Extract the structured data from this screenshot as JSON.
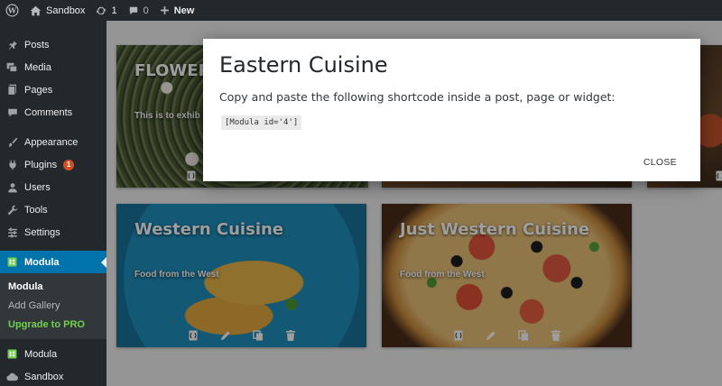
{
  "adminbar": {
    "site_name": "Sandbox",
    "updates_count": "1",
    "comments_count": "0",
    "new_label": "New"
  },
  "sidebar": {
    "items": [
      {
        "label": "Posts",
        "icon": "pin-icon"
      },
      {
        "label": "Media",
        "icon": "media-icon"
      },
      {
        "label": "Pages",
        "icon": "pages-icon"
      },
      {
        "label": "Comments",
        "icon": "comments-icon"
      },
      {
        "label": "Appearance",
        "icon": "brush-icon"
      },
      {
        "label": "Plugins",
        "icon": "plug-icon",
        "badge": "1"
      },
      {
        "label": "Users",
        "icon": "user-icon"
      },
      {
        "label": "Tools",
        "icon": "wrench-icon"
      },
      {
        "label": "Settings",
        "icon": "settings-icon"
      },
      {
        "label": "Modula",
        "icon": "modula-icon"
      }
    ],
    "submenu": [
      "Modula",
      "Add Gallery",
      "Upgrade to PRO"
    ],
    "bottom_items": [
      {
        "label": "Modula",
        "icon": "modula-icon"
      },
      {
        "label": "Sandbox",
        "icon": "cloud-icon"
      }
    ]
  },
  "gallery": {
    "cards": [
      {
        "title": "FLOWERS",
        "description": "This is to exhib"
      },
      {
        "title": "",
        "description": ""
      },
      {
        "title": "",
        "description": ""
      },
      {
        "title": "Western Cuisine",
        "description": "Food from the West"
      },
      {
        "title": "Just Western Cuisine",
        "description": "Food from the West"
      }
    ],
    "action_icons": [
      "shortcode-icon",
      "edit-icon",
      "duplicate-icon",
      "delete-icon"
    ]
  },
  "modal": {
    "title": "Eastern Cuisine",
    "text": "Copy and paste the following shortcode inside a post, page or widget:",
    "shortcode": "[Modula id='4']",
    "close_label": "CLOSE"
  },
  "colors": {
    "adminbar_bg": "#23282d",
    "sidebar_bg": "#23282d",
    "active_menu": "#0073aa",
    "submenu_bg": "#32373c",
    "upgrade_green": "#72d04e",
    "badge": "#d54e21"
  }
}
